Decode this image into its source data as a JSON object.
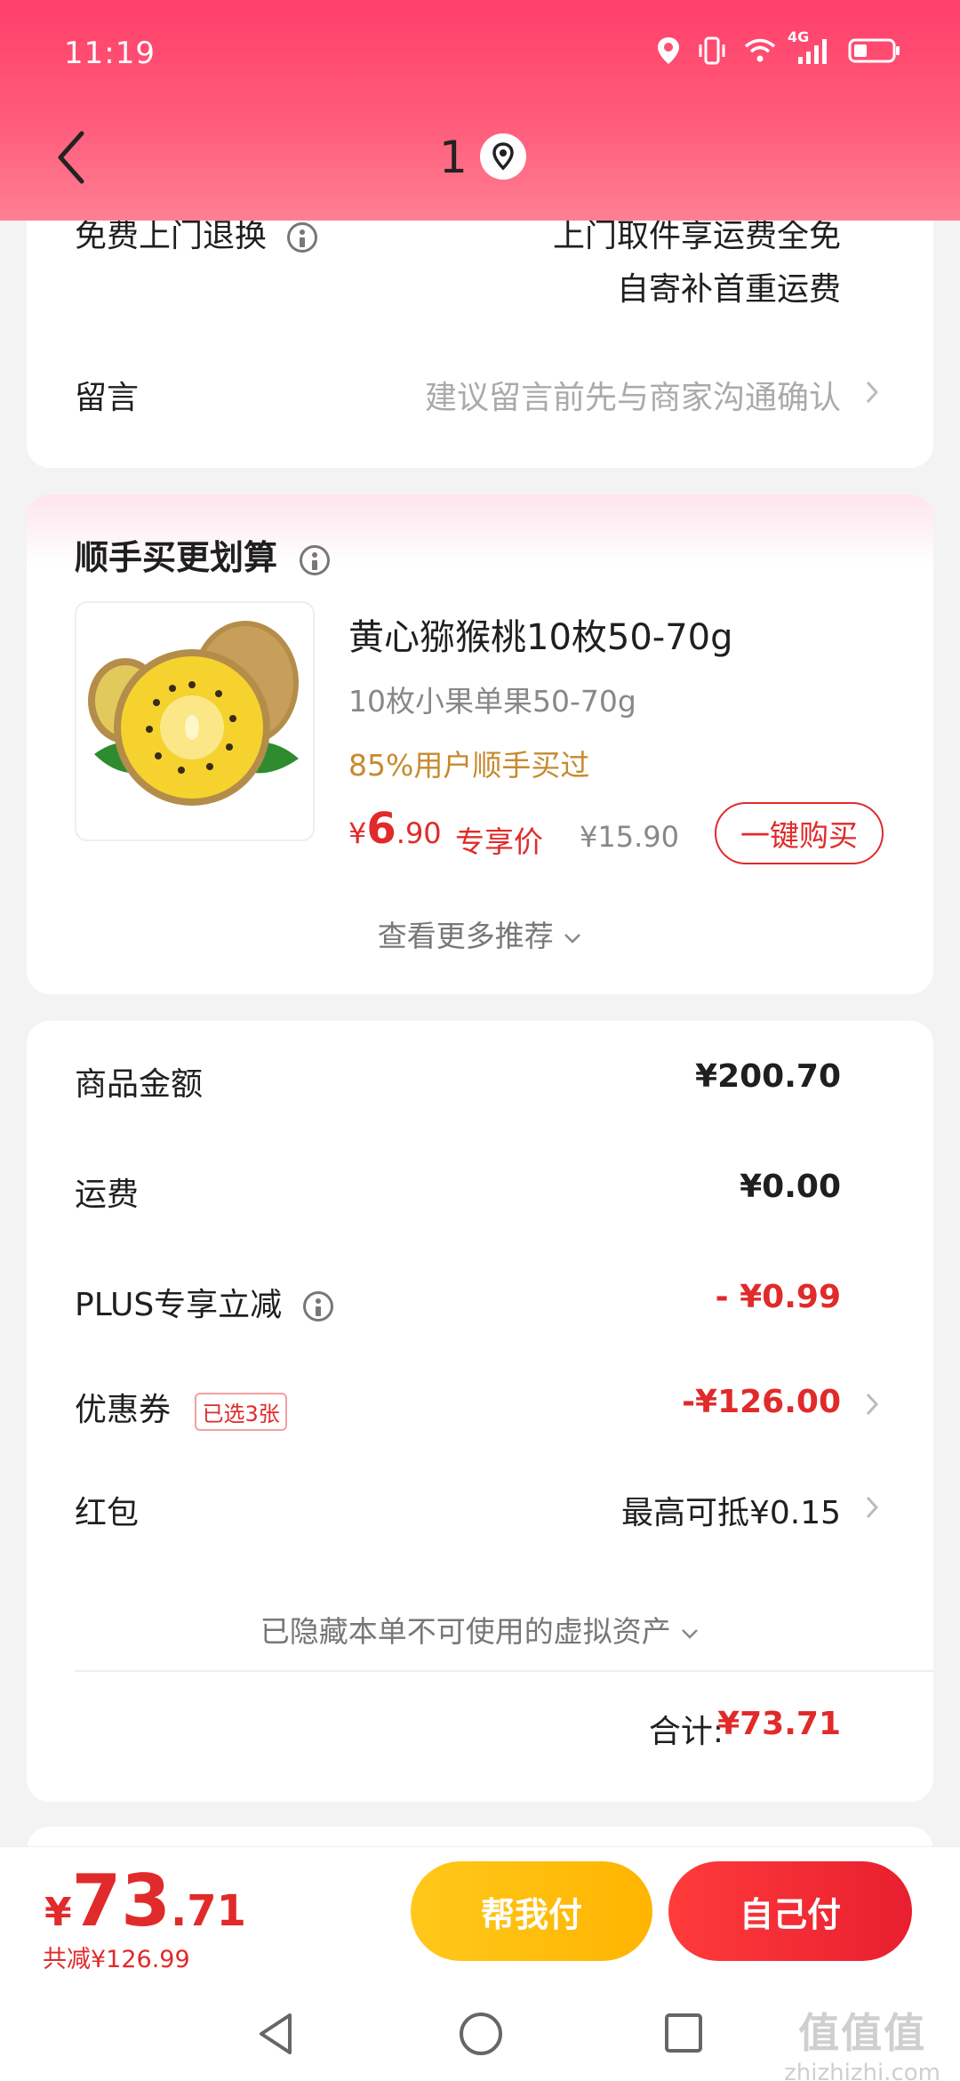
{
  "status_bar": {
    "time": "11:19",
    "network": "4G"
  },
  "header": {
    "title": "1"
  },
  "card_return": {
    "free_return_label": "免费上门退换",
    "free_return_line1": "上门取件享运费全免",
    "free_return_line2": "自寄补首重运费",
    "message_label": "留言",
    "message_placeholder": "建议留言前先与商家沟通确认"
  },
  "recommend": {
    "title": "顺手买更划算",
    "product": {
      "name": "黄心猕猴桃10枚50-70g",
      "spec": "10枚小果单果50-70g",
      "social_proof": "85%用户顺手买过",
      "price_currency": "¥",
      "price_int": "6",
      "price_dec": ".90",
      "price_tag": "专享价",
      "original_price": "¥15.90",
      "buy_button": "一键购买"
    },
    "more": "查看更多推荐"
  },
  "summary": {
    "goods_amount_label": "商品金额",
    "goods_amount": "¥200.70",
    "shipping_label": "运费",
    "shipping": "¥0.00",
    "plus_label": "PLUS专享立减",
    "plus_value": "- ¥0.99",
    "coupon_label": "优惠券",
    "coupon_badge": "已选3张",
    "coupon_value": "-¥126.00",
    "redpacket_label": "红包",
    "redpacket_value": "最高可抵¥0.15",
    "hidden_assets": "已隐藏本单不可使用的虚拟资产",
    "total_label": "合计:",
    "total_value": "¥73.71"
  },
  "bottom_bar": {
    "currency": "¥",
    "total_int": "73",
    "total_dec": ".71",
    "saved": "共减¥126.99",
    "help_pay": "帮我付",
    "self_pay": "自己付"
  },
  "watermark": {
    "glyph": "值值值",
    "text": "zhizhizhi.com"
  },
  "colors": {
    "accent_red": "#e12a2a",
    "header_pink": "#ff4f74",
    "help_yellow": "#ffc107"
  }
}
